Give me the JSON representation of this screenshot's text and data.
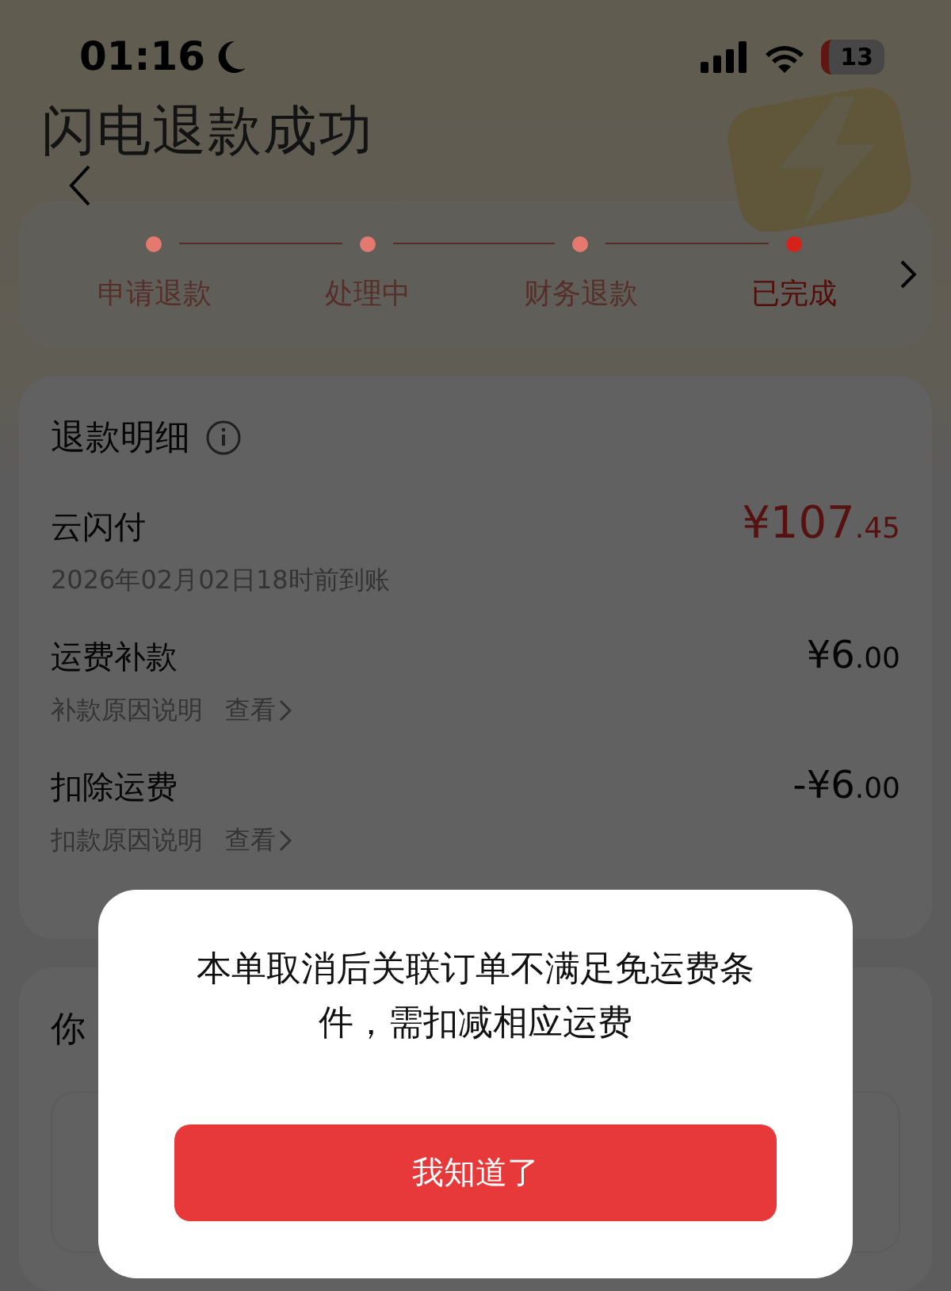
{
  "status_bar": {
    "time": "01:16",
    "battery": "13"
  },
  "header": {
    "title": "闪电退款成功"
  },
  "progress": {
    "steps": [
      {
        "label": "申请退款",
        "selected": false
      },
      {
        "label": "处理中",
        "selected": false
      },
      {
        "label": "财务退款",
        "selected": false
      },
      {
        "label": "已完成",
        "selected": true
      }
    ]
  },
  "refund_detail": {
    "title": "退款明细",
    "rows": [
      {
        "name": "云闪付",
        "amount": "¥107",
        "amount_decimal": ".45",
        "highlight": true,
        "note": "2026年02月02日18时前到账"
      },
      {
        "name": "运费补款",
        "amount": "¥6",
        "amount_decimal": ".00",
        "highlight": false,
        "note": "补款原因说明",
        "link": "查看"
      },
      {
        "name": "扣除运费",
        "amount": "-¥6",
        "amount_decimal": ".00",
        "highlight": false,
        "note": "扣款原因说明",
        "link": "查看"
      }
    ]
  },
  "section_peek": {
    "title": "你"
  },
  "dialog": {
    "message": "本单取消后关联订单不满足免运费条件，需扣减相应运费",
    "button": "我知道了"
  }
}
